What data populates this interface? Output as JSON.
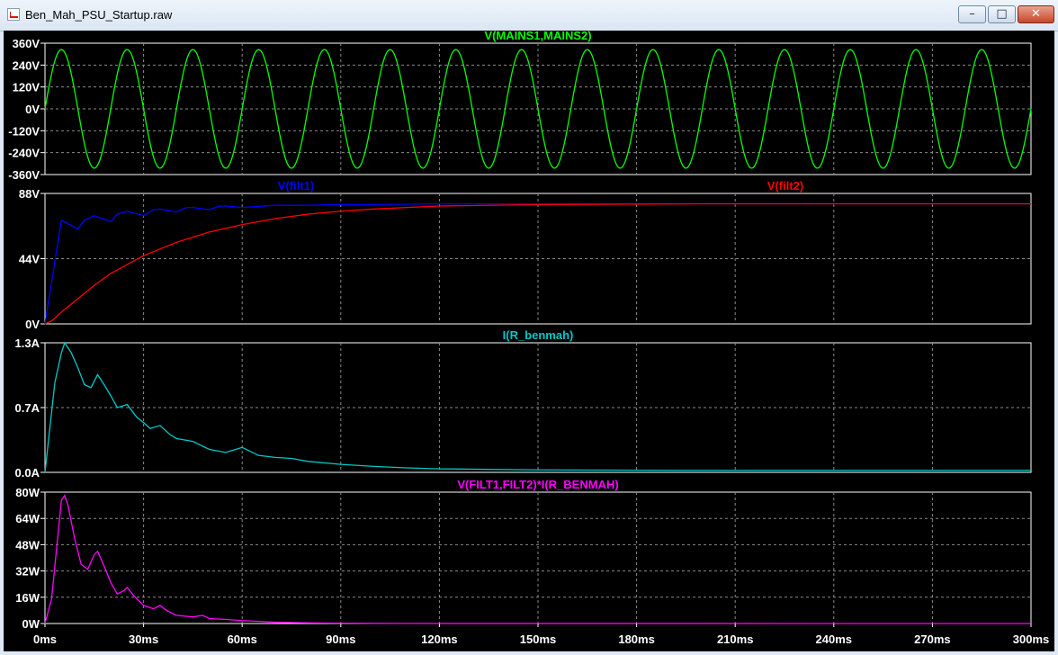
{
  "window": {
    "title": "Ben_Mah_PSU_Startup.raw"
  },
  "chart_data": [
    {
      "type": "line",
      "title": "V(MAINS1,MAINS2)",
      "title_color": "#00ff00",
      "x_unit": "ms",
      "xlim": [
        0,
        300
      ],
      "ylim": [
        -360,
        360
      ],
      "yticks": [
        "360V",
        "240V",
        "120V",
        "0V",
        "-120V",
        "-240V",
        "-360V"
      ],
      "grid": true,
      "series": [
        {
          "name": "V(MAINS1,MAINS2)",
          "color": "#00ff00",
          "kind": "sine",
          "amplitude": 325,
          "frequency_hz": 50
        }
      ]
    },
    {
      "type": "line",
      "title_left": "V(filt1)",
      "title_left_color": "#0000ff",
      "title_right": "V(filt2)",
      "title_right_color": "#ff0000",
      "x_unit": "ms",
      "xlim": [
        0,
        300
      ],
      "ylim": [
        0,
        88
      ],
      "yticks": [
        "88V",
        "44V",
        "0V"
      ],
      "grid": true,
      "series": [
        {
          "name": "V(filt1)",
          "color": "#0000ff",
          "x": [
            0,
            5,
            10,
            12,
            15,
            20,
            22,
            25,
            30,
            33,
            35,
            40,
            43,
            45,
            50,
            53,
            55,
            60,
            70,
            80,
            90,
            100,
            120,
            150,
            200,
            250,
            300
          ],
          "y": [
            0,
            70,
            64,
            70,
            73,
            69,
            74,
            76,
            73,
            77,
            77.5,
            75.5,
            78.5,
            78.5,
            77,
            79.5,
            79.5,
            78.5,
            80,
            80,
            80.5,
            80.5,
            81,
            81,
            81,
            81,
            81
          ]
        },
        {
          "name": "V(filt2)",
          "color": "#ff0000",
          "x": [
            0,
            2,
            5,
            10,
            15,
            20,
            25,
            30,
            40,
            50,
            60,
            70,
            80,
            90,
            100,
            120,
            150,
            200,
            250,
            300
          ],
          "y": [
            0,
            2,
            8,
            17,
            26,
            34,
            40,
            46,
            55,
            62,
            67,
            71,
            74,
            76,
            77.5,
            79.5,
            80.5,
            81,
            81,
            81
          ]
        }
      ]
    },
    {
      "type": "line",
      "title": "I(R_benmah)",
      "title_color": "#00c8c8",
      "x_unit": "ms",
      "xlim": [
        0,
        300
      ],
      "ylim": [
        0,
        1.3
      ],
      "yticks": [
        "1.3A",
        "0.7A",
        "0.0A"
      ],
      "grid": true,
      "series": [
        {
          "name": "I(R_benmah)",
          "color": "#00c8c8",
          "x": [
            0,
            1,
            3,
            5,
            6,
            8,
            10,
            12,
            14,
            16,
            18,
            20,
            22,
            25,
            28,
            30,
            32,
            35,
            38,
            40,
            45,
            50,
            55,
            60,
            65,
            70,
            75,
            80,
            90,
            100,
            110,
            120,
            150,
            200,
            250,
            300
          ],
          "y": [
            0,
            0.3,
            0.9,
            1.2,
            1.3,
            1.2,
            1.05,
            0.88,
            0.85,
            0.98,
            0.88,
            0.77,
            0.65,
            0.68,
            0.55,
            0.5,
            0.44,
            0.47,
            0.38,
            0.34,
            0.31,
            0.23,
            0.2,
            0.25,
            0.17,
            0.15,
            0.14,
            0.11,
            0.08,
            0.06,
            0.045,
            0.035,
            0.025,
            0.02,
            0.02,
            0.02
          ]
        }
      ]
    },
    {
      "type": "line",
      "title": "V(FILT1,FILT2)*I(R_BENMAH)",
      "title_color": "#ff00ff",
      "x_unit": "ms",
      "xlim": [
        0,
        300
      ],
      "ylim": [
        0,
        80
      ],
      "yticks": [
        "80W",
        "64W",
        "48W",
        "32W",
        "16W",
        "0W"
      ],
      "xticks": [
        "0ms",
        "30ms",
        "60ms",
        "90ms",
        "120ms",
        "150ms",
        "180ms",
        "210ms",
        "240ms",
        "270ms",
        "300ms"
      ],
      "grid": true,
      "series": [
        {
          "name": "V(FILT1,FILT2)*I(R_BENMAH)",
          "color": "#ff00ff",
          "x": [
            0,
            2,
            4,
            5,
            6,
            7,
            9,
            11,
            13,
            15,
            16,
            18,
            20,
            22,
            24,
            25,
            27,
            30,
            33,
            35,
            37,
            40,
            45,
            48,
            50,
            55,
            60,
            65,
            70,
            80,
            90,
            100,
            110,
            300
          ],
          "y": [
            0,
            15,
            55,
            75,
            78,
            72,
            52,
            36,
            33,
            42,
            44,
            35,
            25,
            18,
            20,
            22,
            17,
            11,
            9,
            11,
            8,
            5,
            4,
            5,
            3,
            2.5,
            1.8,
            1.3,
            0.8,
            0.4,
            0.2,
            0.1,
            0.05,
            0
          ]
        }
      ]
    }
  ]
}
